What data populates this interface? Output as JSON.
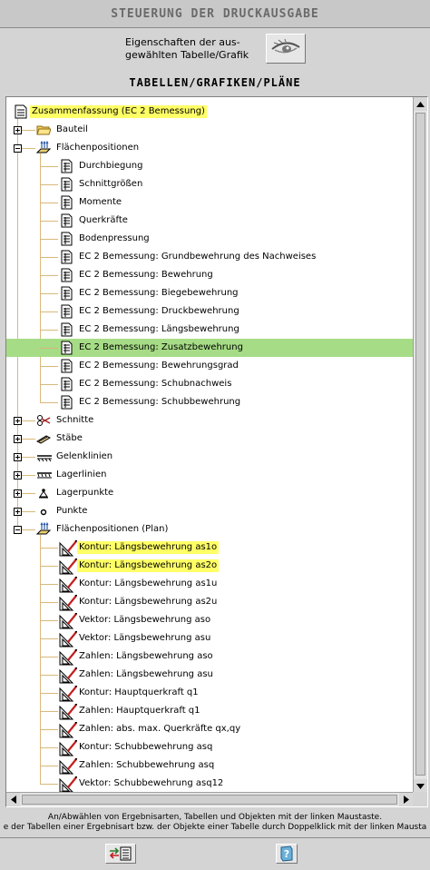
{
  "window": {
    "title": "STEUERUNG DER DRUCKAUSGABE"
  },
  "properties_button": {
    "label": "Eigenschaften der aus-\ngewählten Tabelle/Grafik",
    "icon": "eye-icon"
  },
  "section": {
    "title": "TABELLEN/GRAFIKEN/PLÄNE"
  },
  "tree": {
    "items": [
      {
        "label": "Zusammenfassung (EC 2 Bemessung)",
        "level": 0,
        "icon": "summary-icon",
        "highlight": true
      },
      {
        "label": "Bauteil",
        "level": 1,
        "icon": "folder-icon",
        "expander": "plus"
      },
      {
        "label": "Flächenpositionen",
        "level": 1,
        "icon": "surface-icon",
        "expander": "minus"
      },
      {
        "label": "Durchbiegung",
        "level": 2,
        "icon": "table-icon"
      },
      {
        "label": "Schnittgrößen",
        "level": 2,
        "icon": "table-icon"
      },
      {
        "label": "Momente",
        "level": 2,
        "icon": "table-icon"
      },
      {
        "label": "Querkräfte",
        "level": 2,
        "icon": "table-icon"
      },
      {
        "label": "Bodenpressung",
        "level": 2,
        "icon": "table-icon"
      },
      {
        "label": "EC 2 Bemessung: Grundbewehrung des Nachweises",
        "level": 2,
        "icon": "table-icon"
      },
      {
        "label": "EC 2 Bemessung: Bewehrung",
        "level": 2,
        "icon": "table-icon"
      },
      {
        "label": "EC 2 Bemessung: Biegebewehrung",
        "level": 2,
        "icon": "table-icon"
      },
      {
        "label": "EC 2 Bemessung: Druckbewehrung",
        "level": 2,
        "icon": "table-icon"
      },
      {
        "label": "EC 2 Bemessung: Längsbewehrung",
        "level": 2,
        "icon": "table-icon"
      },
      {
        "label": "EC 2 Bemessung: Zusatzbewehrung",
        "level": 2,
        "icon": "table-icon",
        "selected": true
      },
      {
        "label": "EC 2 Bemessung: Bewehrungsgrad",
        "level": 2,
        "icon": "table-icon"
      },
      {
        "label": "EC 2 Bemessung: Schubnachweis",
        "level": 2,
        "icon": "table-icon"
      },
      {
        "label": "EC 2 Bemessung: Schubbewehrung",
        "level": 2,
        "icon": "table-icon"
      },
      {
        "label": "Schnitte",
        "level": 1,
        "icon": "scissors-icon",
        "expander": "plus"
      },
      {
        "label": "Stäbe",
        "level": 1,
        "icon": "beam-icon",
        "expander": "plus"
      },
      {
        "label": "Gelenklinien",
        "level": 1,
        "icon": "hinge-line-icon",
        "expander": "plus"
      },
      {
        "label": "Lagerlinien",
        "level": 1,
        "icon": "support-line-icon",
        "expander": "plus"
      },
      {
        "label": "Lagerpunkte",
        "level": 1,
        "icon": "support-point-icon",
        "expander": "plus"
      },
      {
        "label": "Punkte",
        "level": 1,
        "icon": "point-icon",
        "expander": "plus"
      },
      {
        "label": "Flächenpositionen (Plan)",
        "level": 1,
        "icon": "surface-icon",
        "expander": "minus"
      },
      {
        "label": "Kontur: Längsbewehrung as1o",
        "level": 2,
        "icon": "drawing-icon",
        "highlight": true
      },
      {
        "label": "Kontur: Längsbewehrung as2o",
        "level": 2,
        "icon": "drawing-icon",
        "highlight": true
      },
      {
        "label": "Kontur: Längsbewehrung as1u",
        "level": 2,
        "icon": "drawing-icon"
      },
      {
        "label": "Kontur: Längsbewehrung as2u",
        "level": 2,
        "icon": "drawing-icon"
      },
      {
        "label": "Vektor: Längsbewehrung aso",
        "level": 2,
        "icon": "drawing-icon"
      },
      {
        "label": "Vektor: Längsbewehrung asu",
        "level": 2,
        "icon": "drawing-icon"
      },
      {
        "label": "Zahlen: Längsbewehrung aso",
        "level": 2,
        "icon": "drawing-icon"
      },
      {
        "label": "Zahlen: Längsbewehrung asu",
        "level": 2,
        "icon": "drawing-icon"
      },
      {
        "label": "Kontur: Hauptquerkraft q1",
        "level": 2,
        "icon": "drawing-icon"
      },
      {
        "label": "Zahlen: Hauptquerkraft q1",
        "level": 2,
        "icon": "drawing-icon"
      },
      {
        "label": "Zahlen: abs. max. Querkräfte qx,qy",
        "level": 2,
        "icon": "drawing-icon"
      },
      {
        "label": "Kontur: Schubbewehrung asq",
        "level": 2,
        "icon": "drawing-icon"
      },
      {
        "label": "Zahlen: Schubbewehrung asq",
        "level": 2,
        "icon": "drawing-icon"
      },
      {
        "label": "Vektor: Schubbewehrung asq12",
        "level": 2,
        "icon": "drawing-icon"
      }
    ]
  },
  "hints": {
    "line1": "An/Abwählen von Ergebnisarten, Tabellen und Objekten mit der linken Maustaste.",
    "line2": "e der Tabellen einer Ergebnisart bzw. der Objekte einer Tabelle durch Doppelklick mit der linken Mausta"
  },
  "footer": {
    "left_icon": "transfer-icon",
    "right_icon": "help-icon"
  },
  "colors": {
    "selection": "#a6dc86",
    "highlight": "#ffff66",
    "tree_lines": "#d9b87a"
  }
}
